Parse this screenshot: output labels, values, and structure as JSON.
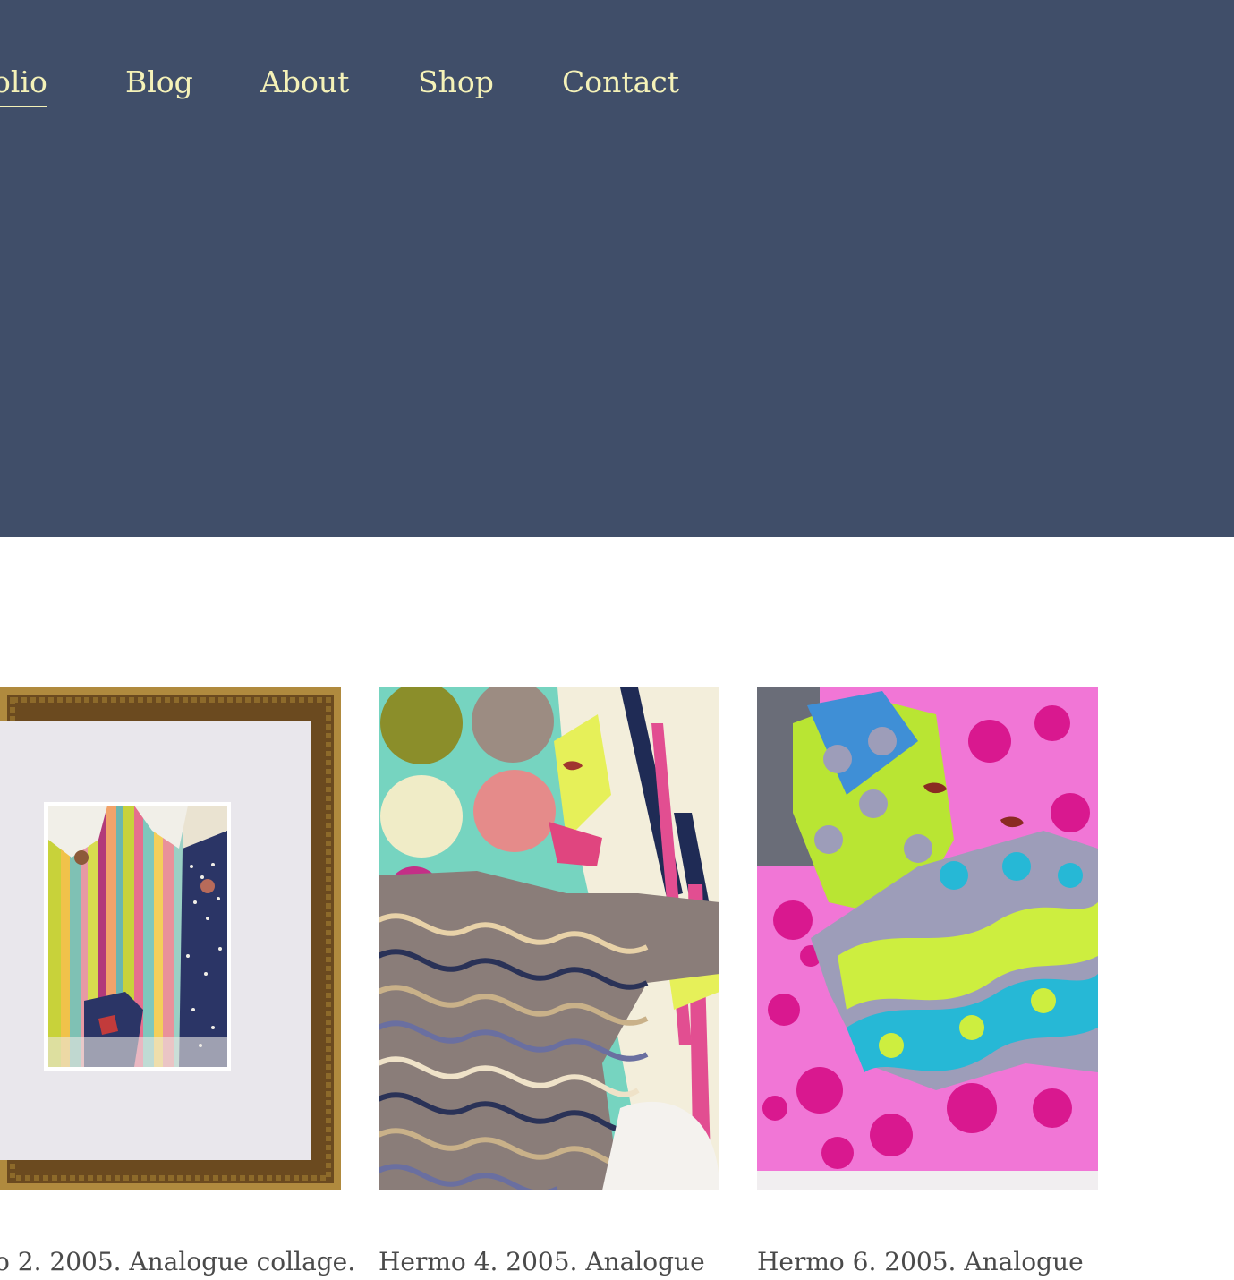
{
  "nav": {
    "items": [
      {
        "label": "olio",
        "active": true
      },
      {
        "label": "Blog",
        "active": false
      },
      {
        "label": "About",
        "active": false
      },
      {
        "label": "Shop",
        "active": false
      },
      {
        "label": "Contact",
        "active": false
      }
    ]
  },
  "gallery": {
    "items": [
      {
        "caption": "o 2. 2005. Analogue collage."
      },
      {
        "caption": "Hermo 4. 2005. Analogue"
      },
      {
        "caption": "Hermo 6. 2005. Analogue"
      }
    ]
  },
  "colors": {
    "header_bg": "#404e69",
    "nav_text": "#f5f2b8",
    "caption_text": "#4a4a4a"
  }
}
